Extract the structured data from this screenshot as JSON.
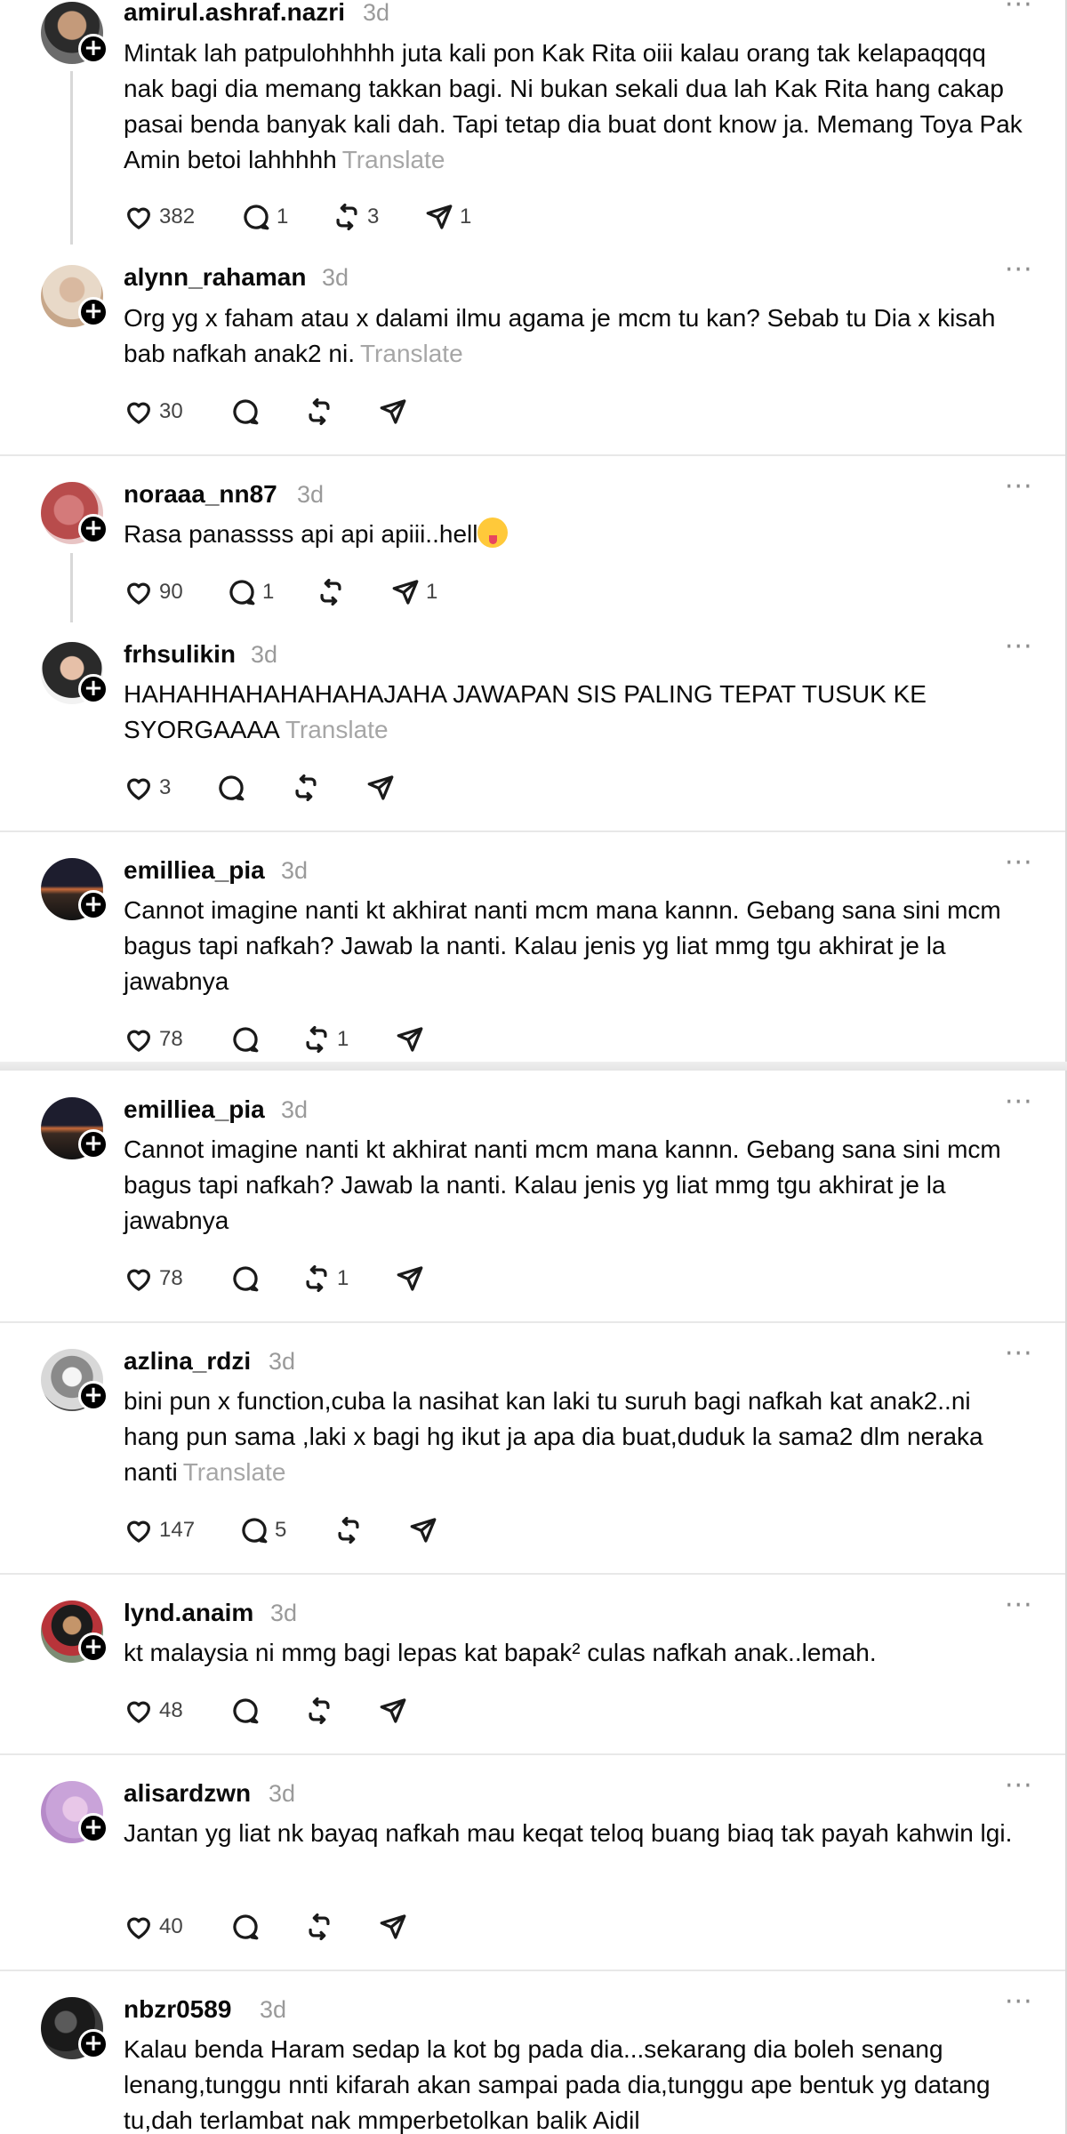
{
  "posts": [
    {
      "username": "amirul.ashraf.nazri",
      "time": "3d",
      "text": "Mintak lah patpulohhhhh juta kali pon Kak Rita oiii kalau orang tak kelapaqqqq nak bagi dia memang takkan bagi. Ni bukan sekali dua lah Kak Rita hang cakap pasai benda banyak kali dah. Tapi tetap dia buat dont know ja. Memang Toya Pak Amin betoi lahhhhh",
      "translate": "Translate",
      "likes": "382",
      "replies": "1",
      "reposts": "3",
      "shares": "1",
      "more": "···"
    },
    {
      "username": "alynn_rahaman",
      "time": "3d",
      "text": "Org yg x faham atau x dalami ilmu agama je mcm tu kan? Sebab tu Dia x kisah bab nafkah anak2 ni.",
      "translate": "Translate",
      "likes": "30",
      "replies": "",
      "reposts": "",
      "shares": "",
      "more": "···"
    },
    {
      "username": "noraaa_nn87",
      "time": "3d",
      "text": "Rasa panassss api api apiii..hell",
      "translate": "",
      "likes": "90",
      "replies": "1",
      "reposts": "",
      "shares": "1",
      "more": "···"
    },
    {
      "username": "frhsulikin",
      "time": "3d",
      "text": "HAHAHHAHAHAHAHAJAHA JAWAPAN SIS PALING TEPAT TUSUK KE SYORGAAAA",
      "translate": "Translate",
      "likes": "3",
      "replies": "",
      "reposts": "",
      "shares": "",
      "more": "···"
    },
    {
      "username": "emilliea_pia",
      "time": "3d",
      "text": "Cannot imagine nanti kt akhirat nanti mcm mana kannn. Gebang sana sini mcm bagus tapi nafkah? Jawab la nanti. Kalau jenis yg liat mmg tgu akhirat je la jawabnya",
      "translate": "",
      "likes": "78",
      "replies": "",
      "reposts": "1",
      "shares": "",
      "more": "···"
    },
    {
      "username": "emilliea_pia",
      "time": "3d",
      "text": "Cannot imagine nanti kt akhirat nanti mcm mana kannn. Gebang sana sini mcm bagus tapi nafkah? Jawab la nanti. Kalau jenis yg liat mmg tgu akhirat je la jawabnya",
      "translate": "",
      "likes": "78",
      "replies": "",
      "reposts": "1",
      "shares": "",
      "more": "···"
    },
    {
      "username": "azlina_rdzi",
      "time": "3d",
      "text": "bini pun x function,cuba la nasihat kan laki tu suruh bagi nafkah kat anak2..ni hang pun sama ,laki x bagi hg ikut ja apa dia buat,duduk la sama2 dlm neraka nanti",
      "translate": "Translate",
      "likes": "147",
      "replies": "5",
      "reposts": "",
      "shares": "",
      "more": "···"
    },
    {
      "username": "lynd.anaim",
      "time": "3d",
      "text": "kt malaysia ni mmg bagi lepas kat bapak² culas nafkah anak..lemah.",
      "translate": "",
      "likes": "48",
      "replies": "",
      "reposts": "",
      "shares": "",
      "more": "···"
    },
    {
      "username": "alisardzwn",
      "time": "3d",
      "text": "Jantan yg liat nk bayaq nafkah mau keqat teloq buang biaq tak payah kahwin lgi.",
      "translate": "",
      "likes": "40",
      "replies": "",
      "reposts": "",
      "shares": "",
      "more": "···"
    },
    {
      "username": "nbzr0589",
      "time": "3d",
      "text": "Kalau benda Haram sedap la kot bg pada dia...sekarang dia boleh senang lenang,tunggu nnti kifarah akan sampai pada dia,tunggu ape bentuk yg datang tu,dah terlambat nak mmperbetolkan balik Aidil",
      "translate": "",
      "likes": "",
      "replies": "",
      "reposts": "",
      "shares": "",
      "more": "···"
    }
  ],
  "icons": {
    "like": "heart-icon",
    "reply": "comment-icon",
    "repost": "repost-icon",
    "share": "send-icon",
    "follow": "plus-icon",
    "more": "more-icon"
  },
  "colors": {
    "text": "#0a0a0a",
    "muted": "#9a9a9a",
    "divider": "#e8e8e8"
  }
}
